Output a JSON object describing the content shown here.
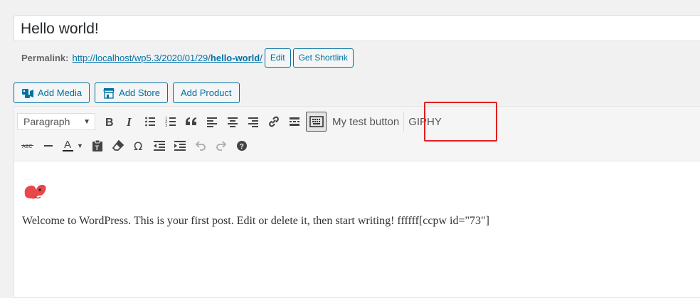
{
  "title": {
    "value": "Hello world!"
  },
  "permalink": {
    "label": "Permalink:",
    "url_prefix": "http://localhost/wp5.3/2020/01/29/",
    "slug": "hello-world",
    "url_suffix": "/",
    "edit_label": "Edit",
    "shortlink_label": "Get Shortlink"
  },
  "media_buttons": {
    "add_media": "Add Media",
    "add_store": "Add Store",
    "add_product": "Add Product"
  },
  "toolbar": {
    "format_select": "Paragraph",
    "row1_icons": [
      "bold-icon",
      "italic-icon",
      "bulleted-list-icon",
      "numbered-list-icon",
      "blockquote-icon",
      "align-left-icon",
      "align-center-icon",
      "align-right-icon",
      "insert-link-icon",
      "read-more-icon",
      "toolbar-toggle-icon"
    ],
    "custom_button": "My test button",
    "giphy_button": "GIPHY",
    "row2_icons": [
      "strikethrough-icon",
      "horizontal-line-icon",
      "text-color-icon",
      "paste-as-text-icon",
      "clear-formatting-icon",
      "special-character-icon",
      "decrease-indent-icon",
      "increase-indent-icon",
      "undo-icon",
      "redo-icon",
      "keyboard-shortcuts-icon"
    ]
  },
  "content": {
    "image_icon": "butterfly-image",
    "paragraph": "Welcome to WordPress. This is your first post. Edit or delete it, then start writing! ffffff[ccpw id=\"73\"]"
  },
  "colors": {
    "accent": "#0071a1",
    "highlight_box": "#e02020",
    "image": "#e8474c"
  }
}
